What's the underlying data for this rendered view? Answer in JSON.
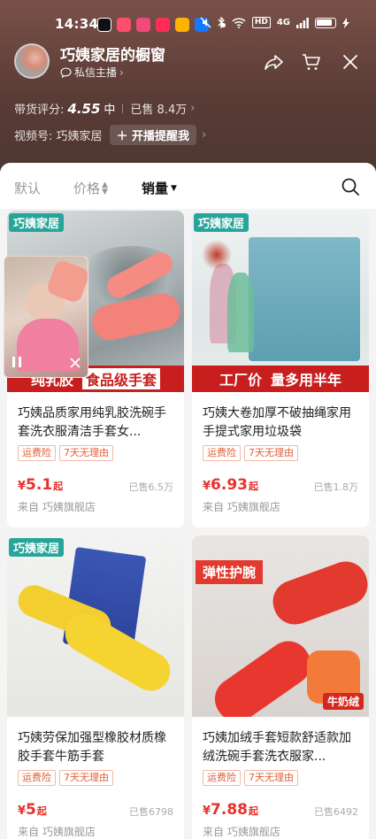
{
  "status_bar": {
    "time": "14:34",
    "network": "4G",
    "hd_label": "HD"
  },
  "header": {
    "shop_name": "巧姨家居的橱窗",
    "dm_label": "私信主播",
    "rating_label": "带货评分:",
    "rating_score": "4.55",
    "rating_level": "中",
    "sold_total": "已售 8.4万",
    "video_label": "视频号: 巧姨家居",
    "remind_button": "＋ 开播提醒我"
  },
  "sort": {
    "default": "默认",
    "price": "价格",
    "sales": "销量"
  },
  "products": [
    {
      "brand_tag": "巧姨家居",
      "banner_left": "纯乳胶",
      "banner_right": "食品级手套",
      "title": "巧姨品质家用纯乳胶洗碗手套洗衣服清洁手套女...",
      "tags": [
        "运费险",
        "7天无理由"
      ],
      "price_symbol": "¥",
      "price": "5.1",
      "price_suffix": "起",
      "sold": "已售6.5万",
      "from": "来自 巧姨旗舰店"
    },
    {
      "brand_tag": "巧姨家居",
      "banner_left": "工厂价",
      "banner_right": "量多用半年",
      "title": "巧姨大卷加厚不破抽绳家用手提式家用垃圾袋",
      "tags": [
        "运费险",
        "7天无理由"
      ],
      "price_symbol": "¥",
      "price": "6.93",
      "price_suffix": "起",
      "sold": "已售1.8万",
      "from": "来自 巧姨旗舰店"
    },
    {
      "brand_tag": "巧姨家居",
      "title": "巧姨劳保加强型橡胶材质橡胶手套牛筋手套",
      "tags": [
        "运费险",
        "7天无理由"
      ],
      "price_symbol": "¥",
      "price": "5",
      "price_suffix": "起",
      "sold": "已售6798",
      "from": "来自 巧姨旗舰店"
    },
    {
      "badge": "弹性护腕",
      "corner_badge": "牛奶绒",
      "title": "巧姨加绒手套短款舒适款加绒洗碗手套洗衣服家...",
      "tags": [
        "运费险",
        "7天无理由"
      ],
      "price_symbol": "¥",
      "price": "7.88",
      "price_suffix": "起",
      "sold": "已售6492",
      "from": "来自 巧姨旗舰店"
    }
  ],
  "colors": {
    "accent": "#e8312c",
    "brand_teal": "#27a59b",
    "header_bg": "#5a3c36",
    "tag_text": "#e0603a"
  },
  "icons": [
    "share-icon",
    "cart-icon",
    "close-icon",
    "search-icon",
    "pause-icon",
    "chat-bubble-icon"
  ]
}
